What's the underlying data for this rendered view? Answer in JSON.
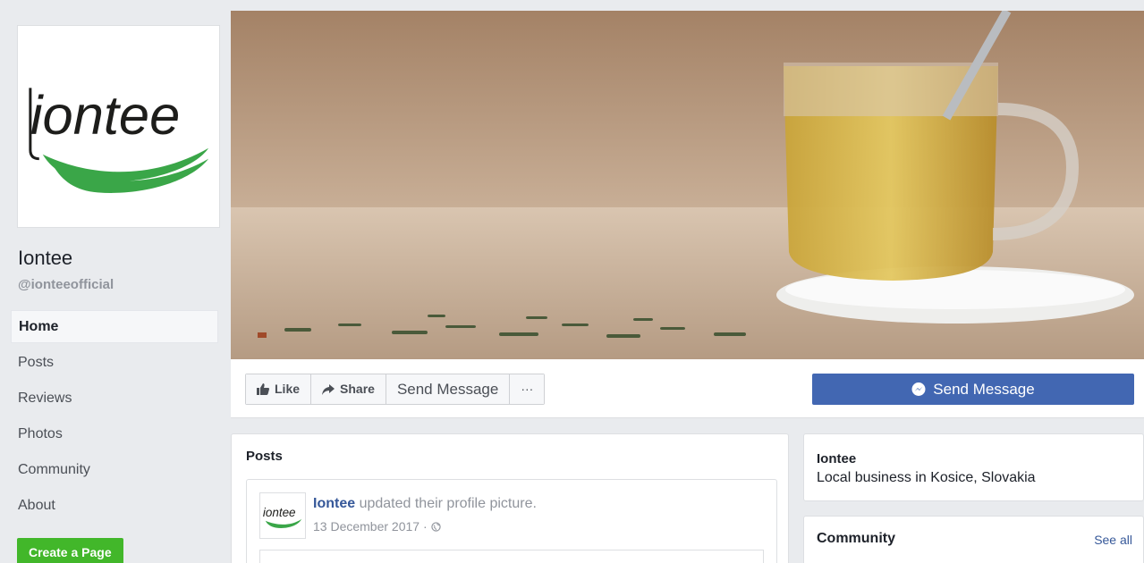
{
  "page": {
    "name": "Iontee",
    "handle": "@ionteeofficial",
    "logo_text": "iontee",
    "brand_green": "#3aa648"
  },
  "nav": {
    "items": [
      {
        "label": "Home",
        "active": true
      },
      {
        "label": "Posts"
      },
      {
        "label": "Reviews"
      },
      {
        "label": "Photos"
      },
      {
        "label": "Community"
      },
      {
        "label": "About"
      }
    ],
    "create_page": "Create a Page"
  },
  "actions": {
    "like": "Like",
    "share": "Share",
    "send_message": "Send Message",
    "more": "···",
    "primary_send": "Send Message",
    "primary_color": "#4267b2"
  },
  "posts": {
    "title": "Posts",
    "items": [
      {
        "author": "Iontee",
        "action": " updated their profile picture.",
        "date": "13 December 2017 ·"
      }
    ]
  },
  "about": {
    "name": "Iontee",
    "category": "Local business in Kosice, Slovakia"
  },
  "community": {
    "title": "Community",
    "see_all": "See all"
  }
}
